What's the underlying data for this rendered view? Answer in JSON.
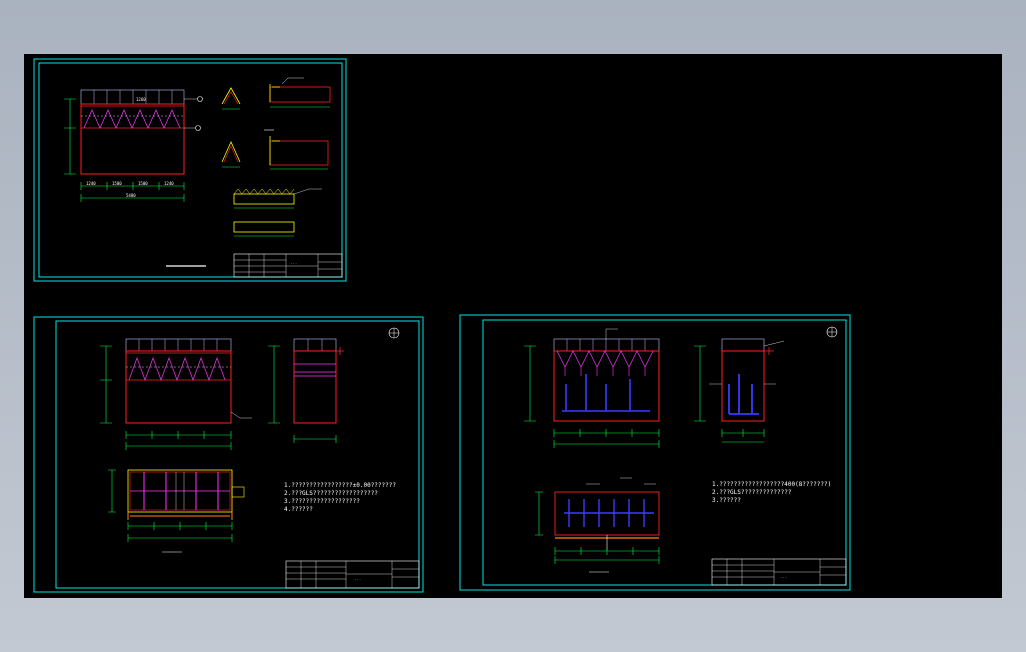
{
  "viewport": {
    "background": "#000000",
    "outer_background": "#b4bcc7"
  },
  "colors": {
    "frame": "#00e5e5",
    "wall": "#ff2020",
    "dim": "#00ff40",
    "grid": "#ffffff",
    "accent": "#ff33ff",
    "pipe": "#3a3aff",
    "note": "#ffffff",
    "title_block_text": "#ff66ff"
  },
  "sheets": [
    {
      "id": "sheet-1",
      "labels": {
        "dims_bottom": [
          "1240",
          "1500",
          "1500",
          "1240"
        ],
        "total": "5480",
        "callout": "1260"
      },
      "title_block": {
        "project": "···"
      }
    },
    {
      "id": "sheet-2",
      "notes": [
        "1.?????????????????±0.00???????",
        "2.???GLS??????????????????",
        "3.???????????????????",
        "4.??????"
      ]
    },
    {
      "id": "sheet-3",
      "notes": [
        "1.??????????????????400(8???????)",
        "2.???GLS??????????????",
        "3.??????"
      ]
    }
  ]
}
